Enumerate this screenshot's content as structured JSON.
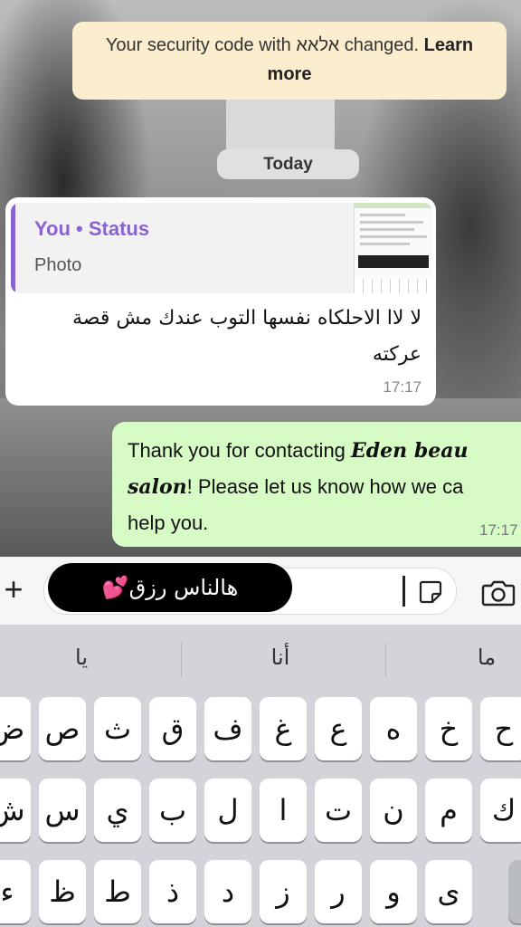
{
  "system_notice": {
    "text": "Your security code with אלאא changed.",
    "link": "Learn more"
  },
  "date_separator": "Today",
  "incoming_message": {
    "quote_author": "You • Status",
    "quote_type": "Photo",
    "text": "لا لاا الاحلكاه نفسها التوب عندك مش قصة عركته",
    "time": "17:17"
  },
  "outgoing_message": {
    "line1_prefix": "Thank you for contacting ",
    "business_name_part1": "Eden beau",
    "line2_name": "salon",
    "line2_suffix": "! Please let us know how we ca",
    "line3": "help you.",
    "time": "17:17"
  },
  "compose": {
    "sticker_text": "هالناس رزق💕"
  },
  "keyboard": {
    "suggestions": [
      "يا",
      "أنا",
      "ما"
    ],
    "row1": [
      "ض",
      "ص",
      "ث",
      "ق",
      "ف",
      "غ",
      "ع",
      "ه",
      "خ",
      "ح"
    ],
    "row2": [
      "ش",
      "س",
      "ي",
      "ب",
      "ل",
      "ا",
      "ت",
      "ن",
      "م",
      "ك"
    ],
    "row3": [
      "ء",
      "ظ",
      "ط",
      "ذ",
      "د",
      "ز",
      "ر",
      "و",
      "ى"
    ]
  }
}
